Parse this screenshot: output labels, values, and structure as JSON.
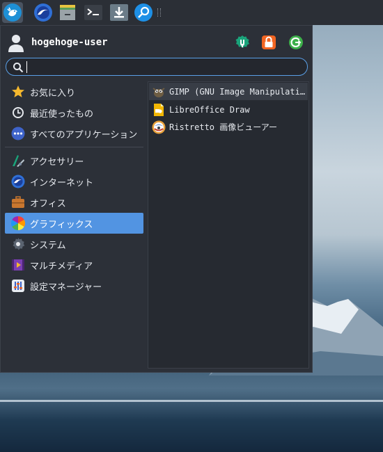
{
  "panel": {
    "items": [
      {
        "icon": "whisker-menu-icon"
      },
      {
        "icon": "web-browser-icon"
      },
      {
        "icon": "file-manager-icon"
      },
      {
        "icon": "terminal-icon"
      },
      {
        "icon": "downloader-icon"
      },
      {
        "icon": "app-finder-icon"
      }
    ]
  },
  "user": {
    "name": "hogehoge-user",
    "actions": [
      {
        "icon": "settings-manager-icon",
        "color": "#1aa37a"
      },
      {
        "icon": "lock-screen-icon",
        "color": "#f26522"
      },
      {
        "icon": "log-out-icon",
        "color": "#3db04a"
      }
    ]
  },
  "search": {
    "value": "",
    "placeholder": ""
  },
  "categories": [
    {
      "label": "お気に入り",
      "icon": "star-icon",
      "selected": false
    },
    {
      "label": "最近使ったもの",
      "icon": "clock-icon",
      "selected": false
    },
    {
      "label": "すべてのアプリケーション",
      "icon": "all-apps-icon",
      "selected": false
    },
    {
      "label": "アクセサリー",
      "icon": "accessories-icon",
      "selected": false
    },
    {
      "label": "インターネット",
      "icon": "internet-icon",
      "selected": false
    },
    {
      "label": "オフィス",
      "icon": "office-icon",
      "selected": false
    },
    {
      "label": "グラフィックス",
      "icon": "graphics-icon",
      "selected": true
    },
    {
      "label": "システム",
      "icon": "system-icon",
      "selected": false
    },
    {
      "label": "マルチメディア",
      "icon": "multimedia-icon",
      "selected": false
    },
    {
      "label": "設定マネージャー",
      "icon": "settings-icon",
      "selected": false
    }
  ],
  "apps": [
    {
      "label": "GIMP (GNU Image Manipulati…",
      "icon": "gimp-icon"
    },
    {
      "label": "LibreOffice Draw",
      "icon": "libreoffice-draw-icon"
    },
    {
      "label": "Ristretto 画像ビューアー",
      "icon": "ristretto-icon"
    }
  ],
  "colors": {
    "accent": "#5294e2",
    "menu_bg": "#2c3038",
    "panel_bg": "#2b2f36"
  }
}
